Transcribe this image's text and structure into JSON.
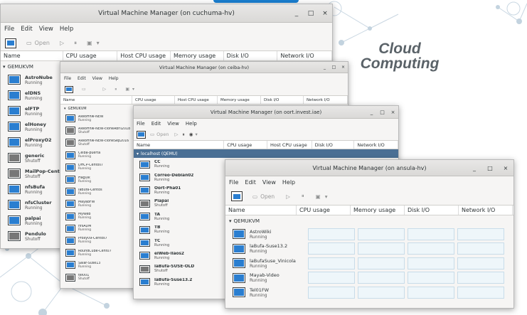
{
  "cloud_text": [
    "Cloud",
    "Computing"
  ],
  "w1": {
    "title": "Virtual Machine Manager (on cuchuma-hv)",
    "controls": [
      "_",
      "□",
      "×"
    ],
    "menus": [
      "File",
      "Edit",
      "View",
      "Help"
    ],
    "toolbar": {
      "open": "Open"
    },
    "headers": [
      "Name",
      "CPU usage",
      "Host CPU usage",
      "Memory usage",
      "Disk I/O",
      "Network I/O"
    ],
    "group": "GEMUKVM",
    "vms": [
      {
        "name": "AstroNube",
        "status": "Running",
        "on": true
      },
      {
        "name": "elDNS",
        "status": "Running",
        "on": true
      },
      {
        "name": "elFTP",
        "status": "Running",
        "on": true
      },
      {
        "name": "elHoney",
        "status": "Running",
        "on": true
      },
      {
        "name": "elProxyO2",
        "status": "Running",
        "on": true
      },
      {
        "name": "generic",
        "status": "Shutoff",
        "on": false
      },
      {
        "name": "MailPop-Cent7",
        "status": "Shutoff",
        "on": false
      },
      {
        "name": "nfsBufa",
        "status": "Running",
        "on": true
      },
      {
        "name": "nfsCluster",
        "status": "Running",
        "on": true
      },
      {
        "name": "palpai",
        "status": "Running",
        "on": true
      },
      {
        "name": "Pendulo",
        "status": "Shutoff",
        "on": false
      }
    ]
  },
  "w2": {
    "title": "Virtual Machine Manager (on ceiba-hv)",
    "controls": [
      "_",
      "□",
      "×"
    ],
    "menus": [
      "File",
      "Edit",
      "View",
      "Help"
    ],
    "headers": [
      "Name",
      "CPU usage",
      "Host CPU usage",
      "Memory usage",
      "Disk I/O",
      "Network I/O"
    ],
    "group": "GEMUKVM",
    "vms": [
      {
        "name": "AxeoHnw-NEW",
        "status": "Running",
        "on": true
      },
      {
        "name": "AxeoHnw-NEW-cloneAbril2018",
        "status": "Shutoff",
        "on": false
      },
      {
        "name": "AxeoHnw-NEW-cloneSep2016",
        "status": "Shutoff",
        "on": false
      },
      {
        "name": "Ceiba-puerta",
        "status": "Running",
        "on": true
      },
      {
        "name": "DHCP-Centos7",
        "status": "Running",
        "on": true
      },
      {
        "name": "Haguik",
        "status": "Running",
        "on": true
      },
      {
        "name": "laBufa-Centos",
        "status": "Running",
        "on": true
      },
      {
        "name": "MayabFW",
        "status": "Running",
        "on": true
      },
      {
        "name": "MyWeb",
        "status": "Running",
        "on": true
      },
      {
        "name": "nfsADM",
        "status": "Running",
        "on": true
      },
      {
        "name": "Proxy09-Centos7",
        "status": "Running",
        "on": true
      },
      {
        "name": "RoundCube-Cent07",
        "status": "Running",
        "on": true
      },
      {
        "name": "Salar-Suse13",
        "status": "Running",
        "on": true
      },
      {
        "name": "tel001",
        "status": "Shutoff",
        "on": false
      }
    ]
  },
  "w3": {
    "title": "Virtual Machine Manager (on oort.invest.iae)",
    "controls": [
      "_",
      "□",
      "×"
    ],
    "menus": [
      "File",
      "Edit",
      "View",
      "Help"
    ],
    "toolbar": {
      "open": "Open"
    },
    "headers": [
      "Name",
      "CPU usage",
      "Host CPU usage",
      "Disk I/O",
      "Network I/O"
    ],
    "group": "localhost (QEMU)",
    "vms": [
      {
        "name": "CC",
        "status": "Running",
        "on": true
      },
      {
        "name": "Correo-Debian02",
        "status": "Running",
        "on": true
      },
      {
        "name": "Oort-Pha01",
        "status": "Running",
        "on": true
      },
      {
        "name": "Piapai",
        "status": "Shutoff",
        "on": false
      },
      {
        "name": "TA",
        "status": "Running",
        "on": true
      },
      {
        "name": "TB",
        "status": "Running",
        "on": true
      },
      {
        "name": "TC",
        "status": "Running",
        "on": true
      },
      {
        "name": "elWeb-llaos2",
        "status": "Running",
        "on": true
      },
      {
        "name": "laBufa-SUSE-OLD",
        "status": "Shutoff",
        "on": false
      },
      {
        "name": "laBufa-Suse13.2",
        "status": "Running",
        "on": true
      }
    ]
  },
  "w4": {
    "title": "Virtual Machine Manager (on ansula-hv)",
    "controls": [
      "_",
      "□",
      "×"
    ],
    "menus": [
      "File",
      "Edit",
      "View",
      "Help"
    ],
    "toolbar": {
      "open": "Open"
    },
    "headers": [
      "Name",
      "CPU usage",
      "Memory usage",
      "Disk I/O",
      "Network I/O"
    ],
    "group": "QEMUKVM",
    "vms": [
      {
        "name": "AstroWiki",
        "status": "Running",
        "on": true
      },
      {
        "name": "laBufa-Suse13.2",
        "status": "Running",
        "on": true
      },
      {
        "name": "laBufaSuse_Vinicola",
        "status": "Running",
        "on": true
      },
      {
        "name": "Mayab-Video",
        "status": "Running",
        "on": true
      },
      {
        "name": "Tel01FW",
        "status": "Running",
        "on": true
      }
    ]
  }
}
